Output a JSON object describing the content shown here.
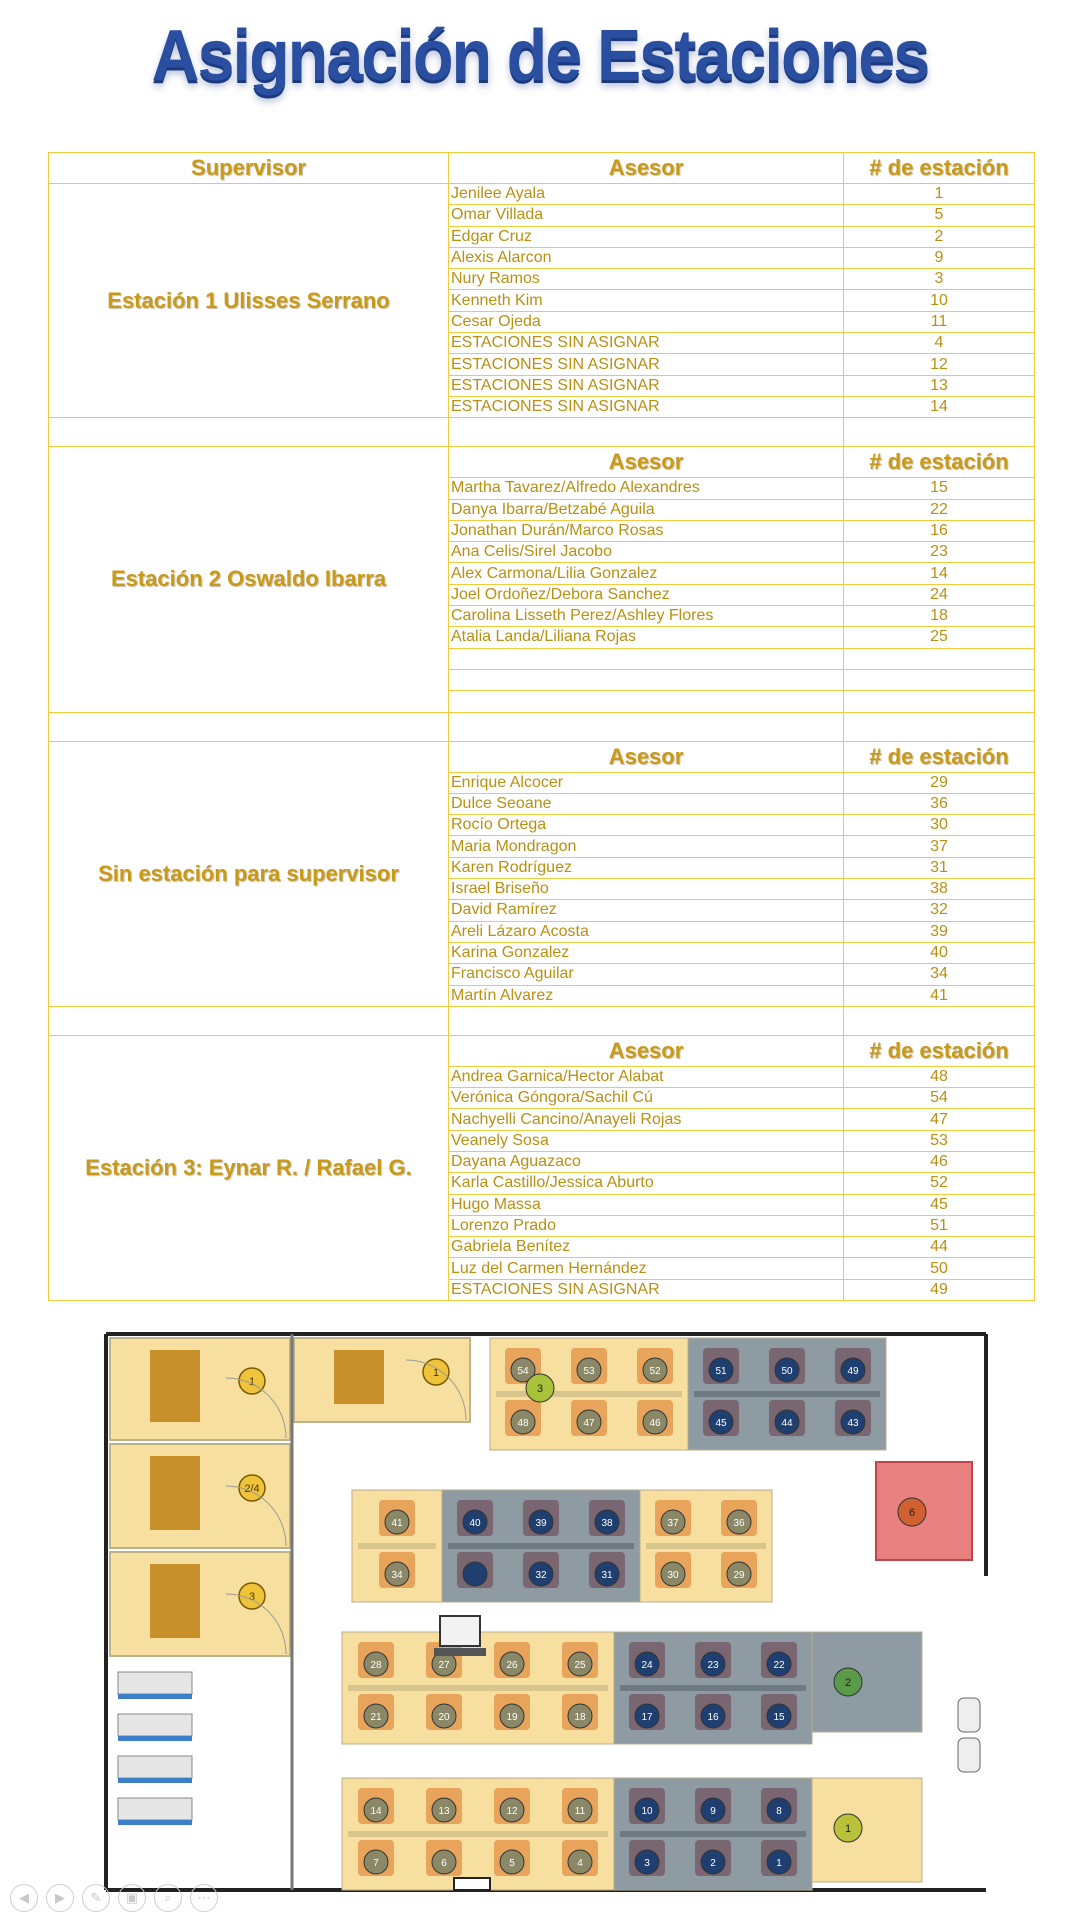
{
  "title": "Asignación de Estaciones",
  "headers": {
    "supervisor": "Supervisor",
    "asesor": "Asesor",
    "estacion": "# de estación"
  },
  "groups": [
    {
      "supervisor": "Estación 1 Ulisses Serrano",
      "rows": [
        [
          "Jenilee Ayala",
          "1"
        ],
        [
          "Omar Villada",
          "5"
        ],
        [
          "Edgar Cruz",
          "2"
        ],
        [
          "Alexis Alarcon",
          "9"
        ],
        [
          "Nury Ramos",
          "3"
        ],
        [
          "Kenneth Kim",
          "10"
        ],
        [
          "Cesar Ojeda",
          "11"
        ],
        [
          "ESTACIONES SIN ASIGNAR",
          "4"
        ],
        [
          "ESTACIONES SIN ASIGNAR",
          "12"
        ],
        [
          "ESTACIONES SIN ASIGNAR",
          "13"
        ],
        [
          "ESTACIONES SIN ASIGNAR",
          "14"
        ]
      ]
    },
    {
      "supervisor": "Estación 2 Oswaldo Ibarra",
      "rows": [
        [
          "Martha Tavarez/Alfredo Alexandres",
          "15"
        ],
        [
          "Danya Ibarra/Betzabé Aguila",
          "22"
        ],
        [
          "Jonathan Durán/Marco Rosas",
          "16"
        ],
        [
          "Ana Celis/Sirel Jacobo",
          "23"
        ],
        [
          "Alex Carmona/Lilia Gonzalez",
          "14"
        ],
        [
          "Joel Ordoñez/Debora Sanchez",
          "24"
        ],
        [
          "Carolina Lisseth Perez/Ashley Flores",
          "18"
        ],
        [
          "Atalia Landa/Liliana Rojas",
          "25"
        ],
        [
          "",
          ""
        ],
        [
          "",
          ""
        ],
        [
          "",
          ""
        ]
      ]
    },
    {
      "supervisor": "Sin estación para supervisor",
      "rows": [
        [
          "Enrique Alcocer",
          "29"
        ],
        [
          "Dulce Seoane",
          "36"
        ],
        [
          "Rocío Ortega",
          "30"
        ],
        [
          "Maria Mondragon",
          "37"
        ],
        [
          "Karen Rodríguez",
          "31"
        ],
        [
          "Israel Briseño",
          "38"
        ],
        [
          "David Ramírez",
          "32"
        ],
        [
          "Areli Lázaro Acosta",
          "39"
        ],
        [
          "Karina Gonzalez",
          "40"
        ],
        [
          "Francisco Aguilar",
          "34"
        ],
        [
          "Martín Alvarez",
          "41"
        ]
      ]
    },
    {
      "supervisor": "Estación 3: Eynar R. / Rafael G.",
      "rows": [
        [
          "Andrea Garnica/Hector Alabat",
          "48"
        ],
        [
          "Verónica Góngora/Sachil Cú",
          "54"
        ],
        [
          "Nachyelli Cancino/Anayeli Rojas",
          "47"
        ],
        [
          "Veanely Sosa",
          "53"
        ],
        [
          "Dayana Aguazaco",
          "46"
        ],
        [
          "Karla Castillo/Jessica Aburto",
          "52"
        ],
        [
          "Hugo Massa",
          "45"
        ],
        [
          "Lorenzo Prado",
          "51"
        ],
        [
          "Gabriela Benítez",
          "44"
        ],
        [
          "Luz del Carmen Hernández",
          "50"
        ],
        [
          "ESTACIONES SIN ASIGNAR",
          "49"
        ]
      ]
    }
  ],
  "floorplan": {
    "offices": [
      "1",
      "2",
      "4",
      "3",
      "1"
    ],
    "pods": [
      {
        "color": "yellow",
        "top": [
          "54",
          "53",
          "52"
        ],
        "bottom": [
          "48",
          "47",
          "46"
        ]
      },
      {
        "color": "gray",
        "top": [
          "51",
          "50",
          "49"
        ],
        "bottom": [
          "45",
          "44",
          "43"
        ]
      },
      {
        "color": "yellow",
        "top": [
          "41"
        ],
        "bottom": [
          "34"
        ]
      },
      {
        "color": "gray",
        "top": [
          "40",
          "39",
          "38"
        ],
        "bottom": [
          "",
          "32",
          "31"
        ]
      },
      {
        "color": "yellow",
        "top": [
          "37",
          "36"
        ],
        "bottom": [
          "30",
          "29"
        ]
      },
      {
        "color": "yellow",
        "top": [
          "28",
          "27",
          "26",
          "25"
        ],
        "bottom": [
          "21",
          "20",
          "19",
          "18"
        ]
      },
      {
        "color": "gray",
        "top": [
          "24",
          "23",
          "22"
        ],
        "bottom": [
          "17",
          "16",
          "15"
        ]
      },
      {
        "color": "yellow",
        "top": [
          "14",
          "13",
          "12",
          "11"
        ],
        "bottom": [
          "7",
          "6",
          "5",
          "4"
        ]
      },
      {
        "color": "gray",
        "top": [
          "10",
          "9",
          "8"
        ],
        "bottom": [
          "3",
          "2",
          "1"
        ]
      }
    ],
    "supervisor_stations": [
      "3",
      "6",
      "2",
      "1"
    ]
  },
  "controls": [
    "prev-icon",
    "next-icon",
    "pen-icon",
    "slides-icon",
    "zoom-icon",
    "more-icon"
  ],
  "colors": {
    "table_border": "#f0cc3c",
    "text": "#b89012",
    "title": "#2a4fa0"
  }
}
